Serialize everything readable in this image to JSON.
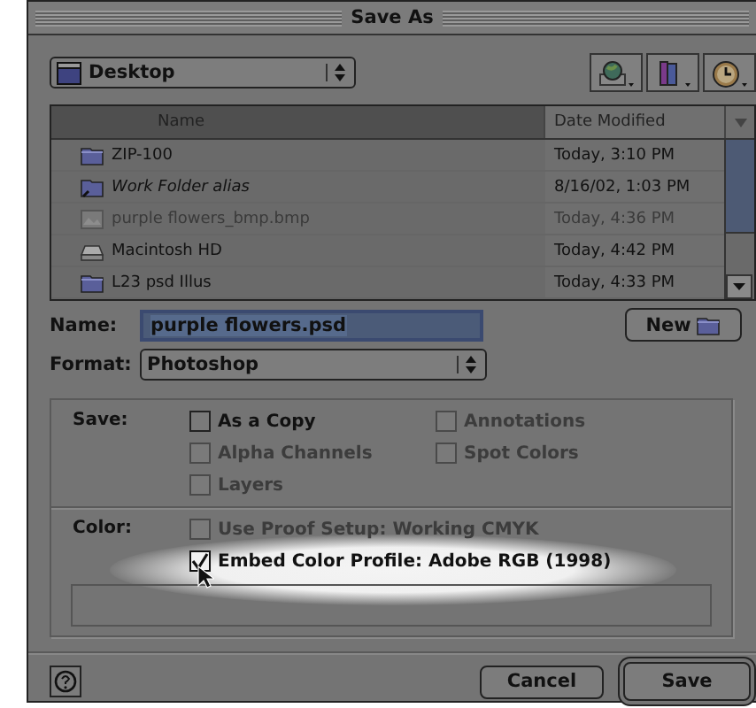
{
  "window": {
    "title": "Save As"
  },
  "location": {
    "label": "Desktop"
  },
  "toolbar": [
    {
      "kind": "network"
    },
    {
      "kind": "favorites"
    },
    {
      "kind": "recent"
    }
  ],
  "file_list": {
    "columns": [
      {
        "label": "Name",
        "sorted": true
      },
      {
        "label": "Date Modified",
        "sorted": false
      }
    ],
    "rows": [
      {
        "name": "ZIP-100",
        "date": "Today, 3:10 PM",
        "kind": "folder",
        "disabled": false
      },
      {
        "name": "Work Folder alias",
        "date": "8/16/02, 1:03 PM",
        "kind": "alias",
        "disabled": false
      },
      {
        "name": "purple flowers_bmp.bmp",
        "date": "Today, 4:36 PM",
        "kind": "file",
        "disabled": true
      },
      {
        "name": "Macintosh HD",
        "date": "Today, 4:42 PM",
        "kind": "disk",
        "disabled": false
      },
      {
        "name": "L23 psd Illus",
        "date": "Today, 4:33 PM",
        "kind": "folder",
        "disabled": false
      }
    ]
  },
  "name_field": {
    "label": "Name:",
    "value": "purple flowers.psd",
    "text_selected": true
  },
  "new_button": {
    "label": "New"
  },
  "format": {
    "label": "Format:",
    "value": "Photoshop"
  },
  "save_options": {
    "label": "Save:",
    "items": [
      {
        "label": "As a Copy",
        "checked": false,
        "disabled": false
      },
      {
        "label": "Annotations",
        "checked": false,
        "disabled": true
      },
      {
        "label": "Alpha Channels",
        "checked": false,
        "disabled": true
      },
      {
        "label": "Spot Colors",
        "checked": false,
        "disabled": true
      },
      {
        "label": "Layers",
        "checked": false,
        "disabled": true
      }
    ]
  },
  "color_options": {
    "label": "Color:",
    "items": [
      {
        "label": "Use Proof Setup: Working CMYK",
        "checked": false,
        "disabled": true,
        "highlighted": false
      },
      {
        "label": "Embed Color Profile: Adobe RGB (1998)",
        "checked": true,
        "disabled": false,
        "highlighted": true
      }
    ]
  },
  "buttons": [
    {
      "label": "Cancel",
      "default": false
    },
    {
      "label": "Save",
      "default": true
    }
  ]
}
